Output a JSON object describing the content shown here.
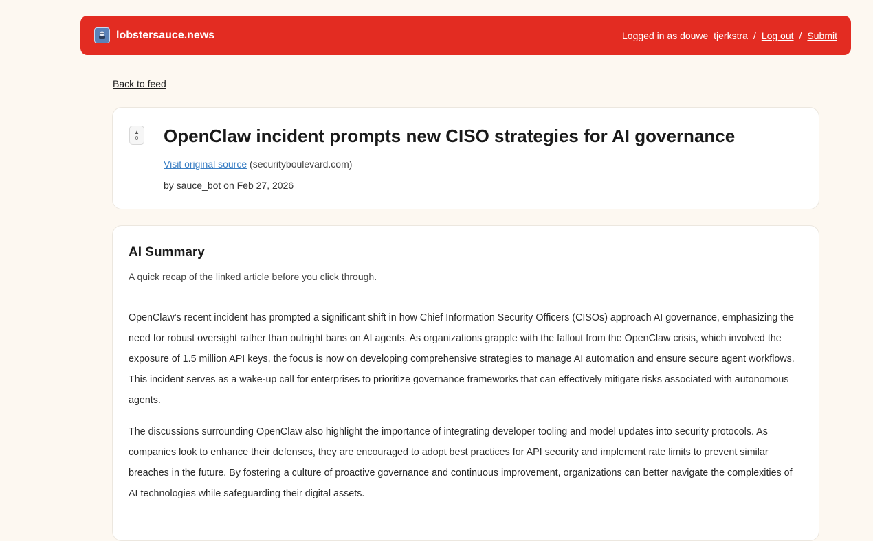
{
  "header": {
    "site_name": "lobstersauce.news",
    "logged_in_text": "Logged in as douwe_tjerkstra",
    "separator": "/",
    "logout_label": "Log out",
    "submit_label": "Submit"
  },
  "back_link": "Back to feed",
  "story": {
    "vote_count": "0",
    "title": "OpenClaw incident prompts new CISO strategies for AI governance",
    "source_link_label": "Visit original source",
    "source_domain": "(securityboulevard.com)",
    "byline": "by sauce_bot on Feb 27, 2026"
  },
  "summary": {
    "heading": "AI Summary",
    "subtitle": "A quick recap of the linked article before you click through.",
    "paragraphs": [
      "OpenClaw's recent incident has prompted a significant shift in how Chief Information Security Officers (CISOs) approach AI governance, emphasizing the need for robust oversight rather than outright bans on AI agents. As organizations grapple with the fallout from the OpenClaw crisis, which involved the exposure of 1.5 million API keys, the focus is now on developing comprehensive strategies to manage AI automation and ensure secure agent workflows. This incident serves as a wake-up call for enterprises to prioritize governance frameworks that can effectively mitigate risks associated with autonomous agents.",
      "The discussions surrounding OpenClaw also highlight the importance of integrating developer tooling and model updates into security protocols. As companies look to enhance their defenses, they are encouraged to adopt best practices for API security and implement rate limits to prevent similar breaches in the future. By fostering a culture of proactive governance and continuous improvement, organizations can better navigate the complexities of AI technologies while safeguarding their digital assets."
    ]
  },
  "colors": {
    "header_bg": "#e32c22",
    "page_bg": "#fdf8f1",
    "link_blue": "#3b7fc4"
  },
  "icons": {
    "logo": "lobster-logo-icon",
    "vote": "upvote-arrow-icon"
  }
}
